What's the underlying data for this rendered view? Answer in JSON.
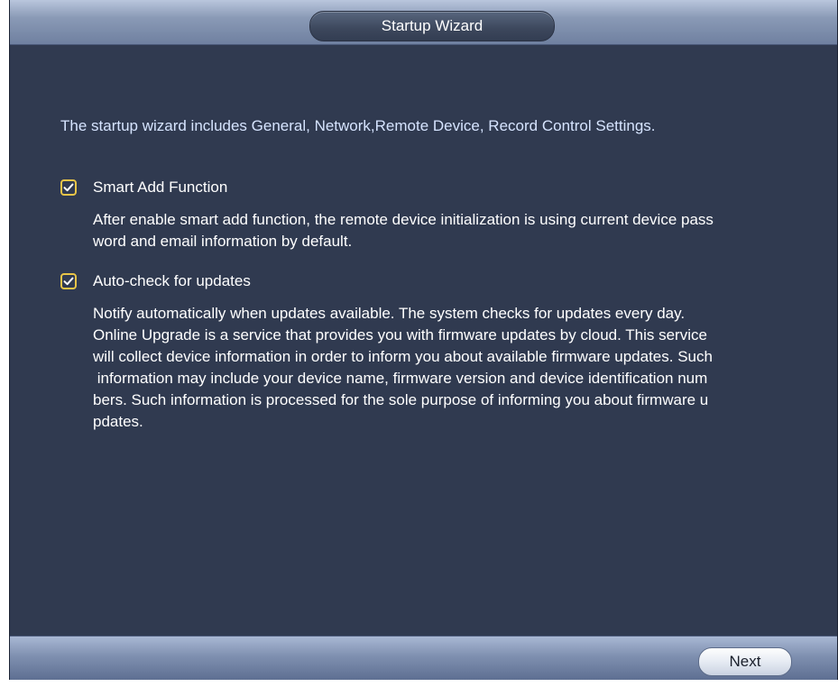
{
  "window": {
    "title": "Startup Wizard"
  },
  "intro_text": "The startup wizard includes General, Network,Remote Device, Record Control Settings.",
  "options": [
    {
      "label": "Smart Add Function",
      "checked": true,
      "description_lines": [
        "After enable smart add function, the remote device initialization is using current device pass",
        "word and email information by default."
      ]
    },
    {
      "label": "Auto-check for updates",
      "checked": true,
      "description_lines": [
        "Notify automatically when updates available. The system checks for updates every day.",
        "Online Upgrade is a service that provides you with firmware updates by cloud. This service",
        "will collect device information in order to inform you about available firmware updates. Such",
        " information may include your device name, firmware version and device identification num",
        "bers. Such information is processed for the sole purpose of informing you about firmware u",
        "pdates."
      ]
    }
  ],
  "footer": {
    "next_label": "Next"
  },
  "colors": {
    "panel_bg": "#303a50",
    "checkbox_border": "#e9c548",
    "intro_text": "#d6e4ff"
  },
  "icons": {
    "checkbox": "checkmark-icon"
  }
}
